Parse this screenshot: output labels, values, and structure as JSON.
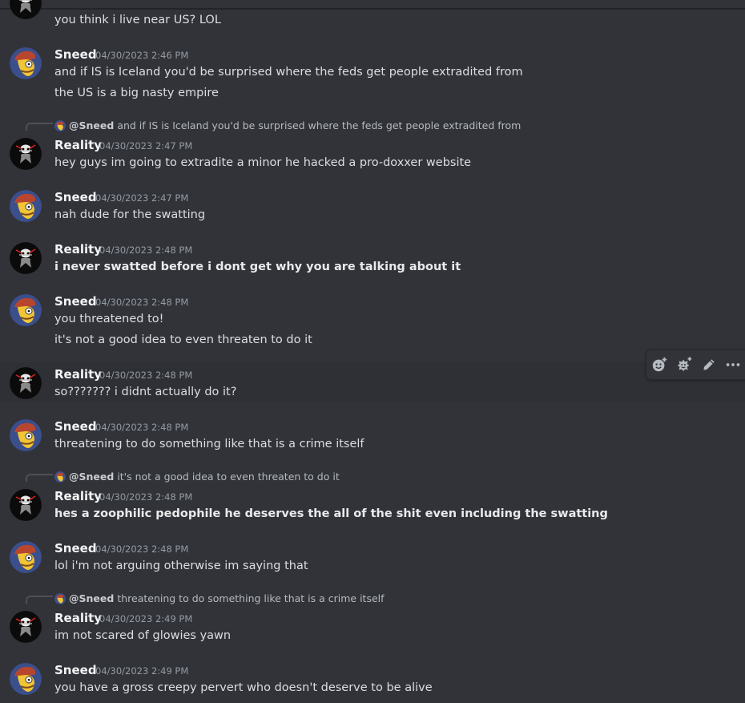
{
  "messages": [
    {
      "kind": "cont",
      "lines": [
        "you think i live near US? LOL"
      ]
    },
    {
      "kind": "msg",
      "author": "Sneed",
      "time": "04/30/2023 2:46 PM",
      "lines": [
        "and if IS is Iceland you'd be surprised where the feds get people extradited from",
        "the US is a big nasty empire"
      ]
    },
    {
      "kind": "msg",
      "author": "Reality",
      "time": "04/30/2023 2:47 PM",
      "reply": {
        "author": "@Sneed",
        "text": "and if IS is Iceland you'd be surprised where the feds get people extradited from"
      },
      "lines": [
        "hey guys im going to extradite a minor he hacked a pro-doxxer website"
      ]
    },
    {
      "kind": "msg",
      "author": "Sneed",
      "time": "04/30/2023 2:47 PM",
      "lines": [
        "nah dude for the swatting"
      ]
    },
    {
      "kind": "msg",
      "author": "Reality",
      "time": "04/30/2023 2:48 PM",
      "lines": [
        "i never swatted before i dont get why you are talking about it"
      ]
    },
    {
      "kind": "msg",
      "author": "Sneed",
      "time": "04/30/2023 2:48 PM",
      "lines": [
        "you threatened to!",
        "it's not a good idea to even threaten to do it"
      ]
    },
    {
      "kind": "msg",
      "author": "Reality",
      "time": "04/30/2023 2:48 PM",
      "lines": [
        "so??????? i didnt actually do it?"
      ]
    },
    {
      "kind": "msg",
      "author": "Sneed",
      "time": "04/30/2023 2:48 PM",
      "lines": [
        "threatening to do something like that is a crime itself"
      ]
    },
    {
      "kind": "msg",
      "author": "Reality",
      "time": "04/30/2023 2:48 PM",
      "reply": {
        "author": "@Sneed",
        "text": "it's not a good idea to even threaten to do it"
      },
      "lines": [
        "hes a zoophilic pedophile he deserves the all of the shit even including the swatting"
      ]
    },
    {
      "kind": "msg",
      "author": "Sneed",
      "time": "04/30/2023 2:48 PM",
      "lines": [
        "lol i'm not arguing otherwise im saying that"
      ]
    },
    {
      "kind": "msg",
      "author": "Reality",
      "time": "04/30/2023 2:49 PM",
      "reply": {
        "author": "@Sneed",
        "text": "threatening to do something like that is a crime itself"
      },
      "lines": [
        "im not scared of glowies yawn"
      ]
    },
    {
      "kind": "msg",
      "author": "Sneed",
      "time": "04/30/2023 2:49 PM",
      "lines": [
        "you have a gross creepy pervert who doesn't deserve to be alive"
      ]
    }
  ],
  "toolbar": {
    "add_reaction_icon": "emoji-add-icon",
    "super_reaction_icon": "super-reaction-icon",
    "edit_icon": "pencil-icon",
    "more_icon": "more-icon"
  },
  "colors": {
    "background": "#313338",
    "hover": "#2e3035",
    "text": "#dbdee1",
    "name": "#f2f3f5",
    "timestamp": "#949ba4"
  }
}
